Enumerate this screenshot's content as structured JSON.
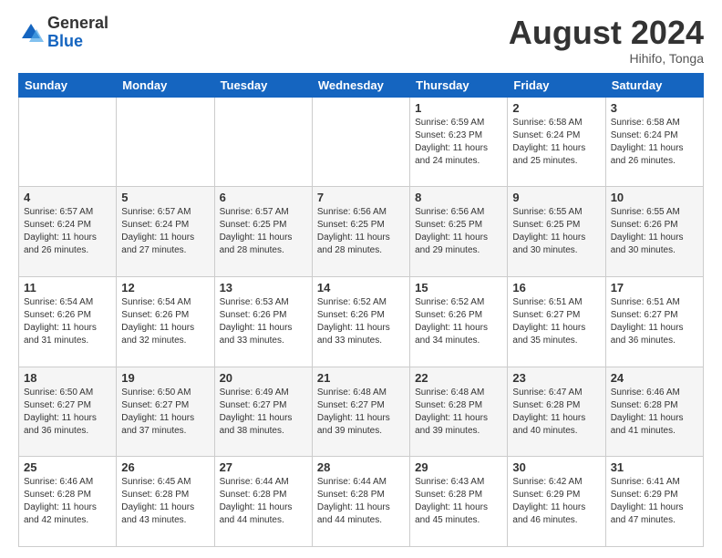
{
  "logo": {
    "general": "General",
    "blue": "Blue"
  },
  "header": {
    "month": "August 2024",
    "location": "Hihifo, Tonga"
  },
  "days_of_week": [
    "Sunday",
    "Monday",
    "Tuesday",
    "Wednesday",
    "Thursday",
    "Friday",
    "Saturday"
  ],
  "weeks": [
    [
      {
        "day": "",
        "info": ""
      },
      {
        "day": "",
        "info": ""
      },
      {
        "day": "",
        "info": ""
      },
      {
        "day": "",
        "info": ""
      },
      {
        "day": "1",
        "info": "Sunrise: 6:59 AM\nSunset: 6:23 PM\nDaylight: 11 hours\nand 24 minutes."
      },
      {
        "day": "2",
        "info": "Sunrise: 6:58 AM\nSunset: 6:24 PM\nDaylight: 11 hours\nand 25 minutes."
      },
      {
        "day": "3",
        "info": "Sunrise: 6:58 AM\nSunset: 6:24 PM\nDaylight: 11 hours\nand 26 minutes."
      }
    ],
    [
      {
        "day": "4",
        "info": "Sunrise: 6:57 AM\nSunset: 6:24 PM\nDaylight: 11 hours\nand 26 minutes."
      },
      {
        "day": "5",
        "info": "Sunrise: 6:57 AM\nSunset: 6:24 PM\nDaylight: 11 hours\nand 27 minutes."
      },
      {
        "day": "6",
        "info": "Sunrise: 6:57 AM\nSunset: 6:25 PM\nDaylight: 11 hours\nand 28 minutes."
      },
      {
        "day": "7",
        "info": "Sunrise: 6:56 AM\nSunset: 6:25 PM\nDaylight: 11 hours\nand 28 minutes."
      },
      {
        "day": "8",
        "info": "Sunrise: 6:56 AM\nSunset: 6:25 PM\nDaylight: 11 hours\nand 29 minutes."
      },
      {
        "day": "9",
        "info": "Sunrise: 6:55 AM\nSunset: 6:25 PM\nDaylight: 11 hours\nand 30 minutes."
      },
      {
        "day": "10",
        "info": "Sunrise: 6:55 AM\nSunset: 6:26 PM\nDaylight: 11 hours\nand 30 minutes."
      }
    ],
    [
      {
        "day": "11",
        "info": "Sunrise: 6:54 AM\nSunset: 6:26 PM\nDaylight: 11 hours\nand 31 minutes."
      },
      {
        "day": "12",
        "info": "Sunrise: 6:54 AM\nSunset: 6:26 PM\nDaylight: 11 hours\nand 32 minutes."
      },
      {
        "day": "13",
        "info": "Sunrise: 6:53 AM\nSunset: 6:26 PM\nDaylight: 11 hours\nand 33 minutes."
      },
      {
        "day": "14",
        "info": "Sunrise: 6:52 AM\nSunset: 6:26 PM\nDaylight: 11 hours\nand 33 minutes."
      },
      {
        "day": "15",
        "info": "Sunrise: 6:52 AM\nSunset: 6:26 PM\nDaylight: 11 hours\nand 34 minutes."
      },
      {
        "day": "16",
        "info": "Sunrise: 6:51 AM\nSunset: 6:27 PM\nDaylight: 11 hours\nand 35 minutes."
      },
      {
        "day": "17",
        "info": "Sunrise: 6:51 AM\nSunset: 6:27 PM\nDaylight: 11 hours\nand 36 minutes."
      }
    ],
    [
      {
        "day": "18",
        "info": "Sunrise: 6:50 AM\nSunset: 6:27 PM\nDaylight: 11 hours\nand 36 minutes."
      },
      {
        "day": "19",
        "info": "Sunrise: 6:50 AM\nSunset: 6:27 PM\nDaylight: 11 hours\nand 37 minutes."
      },
      {
        "day": "20",
        "info": "Sunrise: 6:49 AM\nSunset: 6:27 PM\nDaylight: 11 hours\nand 38 minutes."
      },
      {
        "day": "21",
        "info": "Sunrise: 6:48 AM\nSunset: 6:27 PM\nDaylight: 11 hours\nand 39 minutes."
      },
      {
        "day": "22",
        "info": "Sunrise: 6:48 AM\nSunset: 6:28 PM\nDaylight: 11 hours\nand 39 minutes."
      },
      {
        "day": "23",
        "info": "Sunrise: 6:47 AM\nSunset: 6:28 PM\nDaylight: 11 hours\nand 40 minutes."
      },
      {
        "day": "24",
        "info": "Sunrise: 6:46 AM\nSunset: 6:28 PM\nDaylight: 11 hours\nand 41 minutes."
      }
    ],
    [
      {
        "day": "25",
        "info": "Sunrise: 6:46 AM\nSunset: 6:28 PM\nDaylight: 11 hours\nand 42 minutes."
      },
      {
        "day": "26",
        "info": "Sunrise: 6:45 AM\nSunset: 6:28 PM\nDaylight: 11 hours\nand 43 minutes."
      },
      {
        "day": "27",
        "info": "Sunrise: 6:44 AM\nSunset: 6:28 PM\nDaylight: 11 hours\nand 44 minutes."
      },
      {
        "day": "28",
        "info": "Sunrise: 6:44 AM\nSunset: 6:28 PM\nDaylight: 11 hours\nand 44 minutes."
      },
      {
        "day": "29",
        "info": "Sunrise: 6:43 AM\nSunset: 6:28 PM\nDaylight: 11 hours\nand 45 minutes."
      },
      {
        "day": "30",
        "info": "Sunrise: 6:42 AM\nSunset: 6:29 PM\nDaylight: 11 hours\nand 46 minutes."
      },
      {
        "day": "31",
        "info": "Sunrise: 6:41 AM\nSunset: 6:29 PM\nDaylight: 11 hours\nand 47 minutes."
      }
    ]
  ]
}
